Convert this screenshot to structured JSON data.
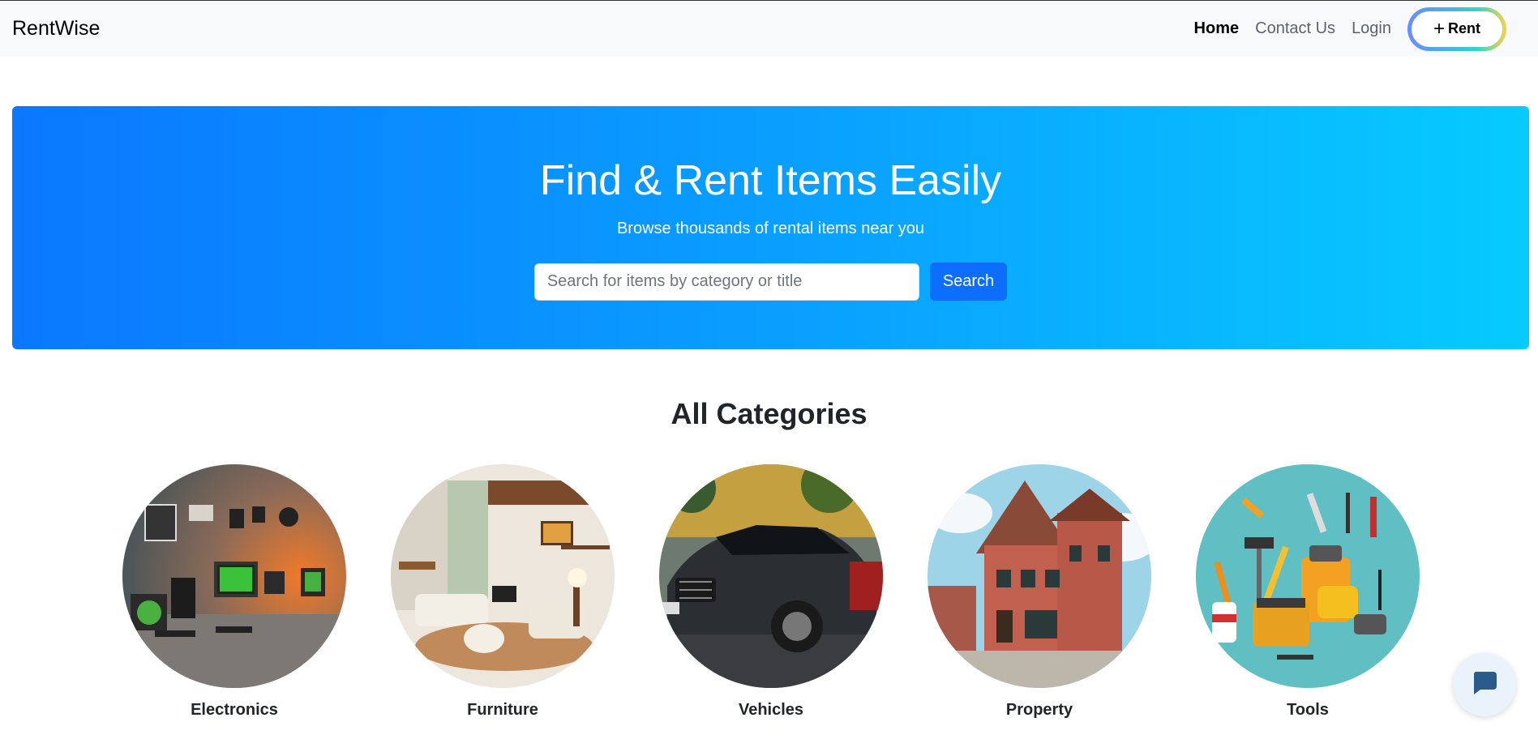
{
  "navbar": {
    "brand": "RentWise",
    "links": [
      {
        "label": "Home",
        "active": true
      },
      {
        "label": "Contact Us",
        "active": false
      },
      {
        "label": "Login",
        "active": false
      }
    ],
    "rent_button": {
      "icon": "plus-icon",
      "label": "Rent"
    }
  },
  "hero": {
    "title": "Find & Rent Items Easily",
    "subtitle": "Browse thousands of rental items near you",
    "search": {
      "placeholder": "Search for items by category or title",
      "value": "",
      "button_label": "Search"
    }
  },
  "categories": {
    "title": "All Categories",
    "items": [
      {
        "label": "Electronics",
        "image": "electronics-image"
      },
      {
        "label": "Furniture",
        "image": "furniture-image"
      },
      {
        "label": "Vehicles",
        "image": "vehicles-image"
      },
      {
        "label": "Property",
        "image": "property-image"
      },
      {
        "label": "Tools",
        "image": "tools-image"
      }
    ]
  },
  "chat": {
    "icon": "chat-bubble-icon"
  },
  "colors": {
    "hero_gradient_start": "#0a78ff",
    "hero_gradient_end": "#06cbff",
    "primary_button": "#0d6efd",
    "navbar_bg": "#f8f9fa"
  }
}
